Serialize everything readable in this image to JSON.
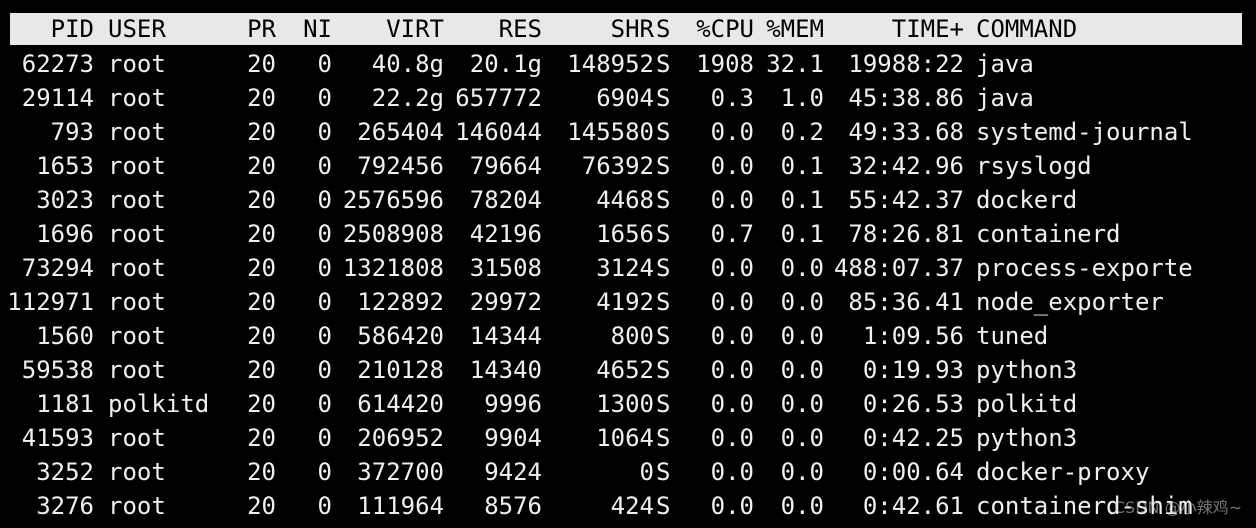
{
  "header": {
    "pid": "PID",
    "user": "USER",
    "pr": "PR",
    "ni": "NI",
    "virt": "VIRT",
    "res": "RES",
    "shr": "SHR",
    "s": "S",
    "cpu": "%CPU",
    "mem": "%MEM",
    "time": "TIME+",
    "command": "COMMAND"
  },
  "processes": [
    {
      "pid": "62273",
      "user": "root",
      "pr": "20",
      "ni": "0",
      "virt": "40.8g",
      "res": "20.1g",
      "shr": "148952",
      "s": "S",
      "cpu": "1908",
      "mem": "32.1",
      "time": "19988:22",
      "command": "java"
    },
    {
      "pid": "29114",
      "user": "root",
      "pr": "20",
      "ni": "0",
      "virt": "22.2g",
      "res": "657772",
      "shr": "6904",
      "s": "S",
      "cpu": "0.3",
      "mem": "1.0",
      "time": "45:38.86",
      "command": "java"
    },
    {
      "pid": "793",
      "user": "root",
      "pr": "20",
      "ni": "0",
      "virt": "265404",
      "res": "146044",
      "shr": "145580",
      "s": "S",
      "cpu": "0.0",
      "mem": "0.2",
      "time": "49:33.68",
      "command": "systemd-journal"
    },
    {
      "pid": "1653",
      "user": "root",
      "pr": "20",
      "ni": "0",
      "virt": "792456",
      "res": "79664",
      "shr": "76392",
      "s": "S",
      "cpu": "0.0",
      "mem": "0.1",
      "time": "32:42.96",
      "command": "rsyslogd"
    },
    {
      "pid": "3023",
      "user": "root",
      "pr": "20",
      "ni": "0",
      "virt": "2576596",
      "res": "78204",
      "shr": "4468",
      "s": "S",
      "cpu": "0.0",
      "mem": "0.1",
      "time": "55:42.37",
      "command": "dockerd"
    },
    {
      "pid": "1696",
      "user": "root",
      "pr": "20",
      "ni": "0",
      "virt": "2508908",
      "res": "42196",
      "shr": "1656",
      "s": "S",
      "cpu": "0.7",
      "mem": "0.1",
      "time": "78:26.81",
      "command": "containerd"
    },
    {
      "pid": "73294",
      "user": "root",
      "pr": "20",
      "ni": "0",
      "virt": "1321808",
      "res": "31508",
      "shr": "3124",
      "s": "S",
      "cpu": "0.0",
      "mem": "0.0",
      "time": "488:07.37",
      "command": "process-exporte"
    },
    {
      "pid": "112971",
      "user": "root",
      "pr": "20",
      "ni": "0",
      "virt": "122892",
      "res": "29972",
      "shr": "4192",
      "s": "S",
      "cpu": "0.0",
      "mem": "0.0",
      "time": "85:36.41",
      "command": "node_exporter"
    },
    {
      "pid": "1560",
      "user": "root",
      "pr": "20",
      "ni": "0",
      "virt": "586420",
      "res": "14344",
      "shr": "800",
      "s": "S",
      "cpu": "0.0",
      "mem": "0.0",
      "time": "1:09.56",
      "command": "tuned"
    },
    {
      "pid": "59538",
      "user": "root",
      "pr": "20",
      "ni": "0",
      "virt": "210128",
      "res": "14340",
      "shr": "4652",
      "s": "S",
      "cpu": "0.0",
      "mem": "0.0",
      "time": "0:19.93",
      "command": "python3"
    },
    {
      "pid": "1181",
      "user": "polkitd",
      "pr": "20",
      "ni": "0",
      "virt": "614420",
      "res": "9996",
      "shr": "1300",
      "s": "S",
      "cpu": "0.0",
      "mem": "0.0",
      "time": "0:26.53",
      "command": "polkitd"
    },
    {
      "pid": "41593",
      "user": "root",
      "pr": "20",
      "ni": "0",
      "virt": "206952",
      "res": "9904",
      "shr": "1064",
      "s": "S",
      "cpu": "0.0",
      "mem": "0.0",
      "time": "0:42.25",
      "command": "python3"
    },
    {
      "pid": "3252",
      "user": "root",
      "pr": "20",
      "ni": "0",
      "virt": "372700",
      "res": "9424",
      "shr": "0",
      "s": "S",
      "cpu": "0.0",
      "mem": "0.0",
      "time": "0:00.64",
      "command": "docker-proxy"
    },
    {
      "pid": "3276",
      "user": "root",
      "pr": "20",
      "ni": "0",
      "virt": "111964",
      "res": "8576",
      "shr": "424",
      "s": "S",
      "cpu": "0.0",
      "mem": "0.0",
      "time": "0:42.61",
      "command": "containerd-shim"
    }
  ],
  "watermark": "CSDN @小辣鸡~",
  "colors": {
    "background": "#000000",
    "text": "#f0f0f0",
    "header_bg": "#e8e8e8",
    "header_text": "#000000"
  }
}
